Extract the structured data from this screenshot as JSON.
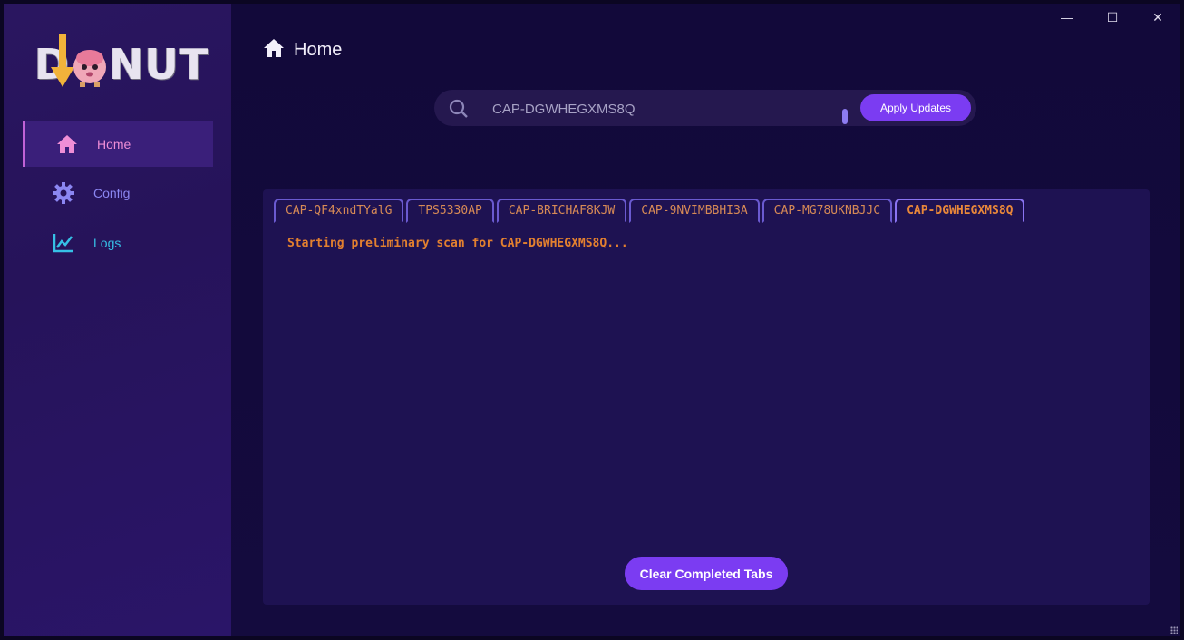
{
  "app": {
    "logo_text": "DONUT",
    "logo_letters": [
      "D",
      "O",
      "NUT"
    ]
  },
  "sidebar": {
    "items": [
      {
        "label": "Home",
        "icon": "home-icon",
        "active": true,
        "color": "#ef8ed6"
      },
      {
        "label": "Config",
        "icon": "gear-icon",
        "active": false,
        "color": "#8b86f2"
      },
      {
        "label": "Logs",
        "icon": "chart-line-icon",
        "active": false,
        "color": "#36c0e6"
      }
    ]
  },
  "window_controls": {
    "minimize": "—",
    "maximize": "☐",
    "close": "✕"
  },
  "header": {
    "title": "Home",
    "icon": "home-icon"
  },
  "search": {
    "value": "CAP-DGWHEGXMS8Q",
    "icon": "search-icon",
    "apply_label": "Apply Updates"
  },
  "tabs": [
    {
      "label": "CAP-QF4xndTYalG",
      "active": false
    },
    {
      "label": "TPS5330AP",
      "active": false
    },
    {
      "label": "CAP-BRICHAF8KJW",
      "active": false
    },
    {
      "label": "CAP-9NVIMBBHI3A",
      "active": false
    },
    {
      "label": "CAP-MG78UKNBJJC",
      "active": false
    },
    {
      "label": "CAP-DGWHEGXMS8Q",
      "active": true
    }
  ],
  "log": {
    "line": "Starting preliminary scan for CAP-DGWHEGXMS8Q..."
  },
  "actions": {
    "clear_label": "Clear Completed Tabs"
  },
  "colors": {
    "accent": "#7b3cf2",
    "log_text": "#e3802f",
    "sidebar_bg": "#26135a",
    "main_bg": "#130a3a",
    "panel_bg": "#1e1252"
  }
}
